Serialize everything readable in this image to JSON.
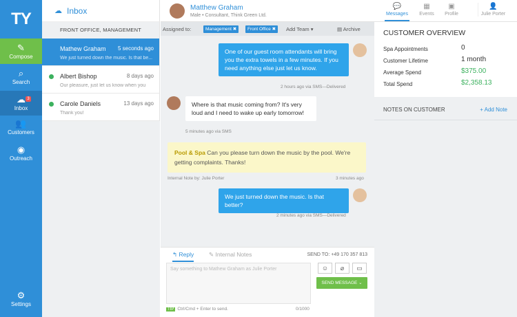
{
  "nav": {
    "logo": "TY",
    "compose": "Compose",
    "search": "Search",
    "inbox": "Inbox",
    "inbox_badge": "3",
    "customers": "Customers",
    "outreach": "Outreach",
    "settings": "Settings"
  },
  "inbox": {
    "title": "Inbox",
    "section": "FRONT OFFICE, MANAGEMENT",
    "conversations": [
      {
        "name": "Mathew Graham",
        "time": "5 seconds ago",
        "preview": "We just turned down the music. Is that be..."
      },
      {
        "name": "Albert Bishop",
        "time": "8 days ago",
        "preview": "Our pleasure, just let us know when you"
      },
      {
        "name": "Carole Daniels",
        "time": "13 days ago",
        "preview": "Thank you!"
      }
    ]
  },
  "chat": {
    "name": "Matthew Graham",
    "subtitle": "Male • Consultant, Think Green Ltd.",
    "assigned_label": "Assigned to:",
    "tags": [
      "Management ✖",
      "Front Office ✖"
    ],
    "add_team": "Add Team ▾",
    "archive": "Archive",
    "messages": [
      {
        "text": "One of our guest room attendants will bring you the extra towels in a few minutes. If you need anything else just let us know.",
        "meta": "2 hours ago via SMS—Delivered"
      },
      {
        "text": "Where is that music coming from? It's very loud and I need to wake up early tomorrow!",
        "meta": "5 minutes ago via SMS"
      },
      {
        "prefix": "Pool & Spa",
        "text": " Can you please turn down the music by the pool. We're getting complaints. Thanks!",
        "meta_left": "Internal Note by: Julie Porter",
        "meta_right": "3 minutes ago"
      },
      {
        "text": "We just turned down the music. Is that better?",
        "meta": "2 minutes ago via SMS—Delivered"
      }
    ],
    "reply_tab": "↰ Reply",
    "notes_tab": "✎ Internal Notes",
    "send_to": "SEND TO: +49 170 357 813",
    "placeholder": "Say something to Mathew Graham as Julie Porter",
    "send_button": "SEND MESSAGE ⌄",
    "tip": "Ctrl/Cmd + Enter to send.",
    "tip_badge": "TIP",
    "count": "0/1000"
  },
  "right": {
    "tabs": [
      "Messages",
      "Events",
      "Profile"
    ],
    "user": "Julie Porter",
    "overview_title": "CUSTOMER OVERVIEW",
    "rows": [
      {
        "label": "Spa Appointments",
        "value": "0"
      },
      {
        "label": "Customer Lifetime",
        "value": "1 month"
      },
      {
        "label": "Average Spend",
        "value": "$375.00"
      },
      {
        "label": "Total Spend",
        "value": "$2,358.13"
      }
    ],
    "notes_title": "NOTES ON CUSTOMER",
    "add_note": "+ Add Note"
  },
  "colors": {
    "primary": "#2f8fd8",
    "green": "#6fbf4a",
    "note": "#fbf7c9",
    "bubble": "#2fa4ea"
  }
}
